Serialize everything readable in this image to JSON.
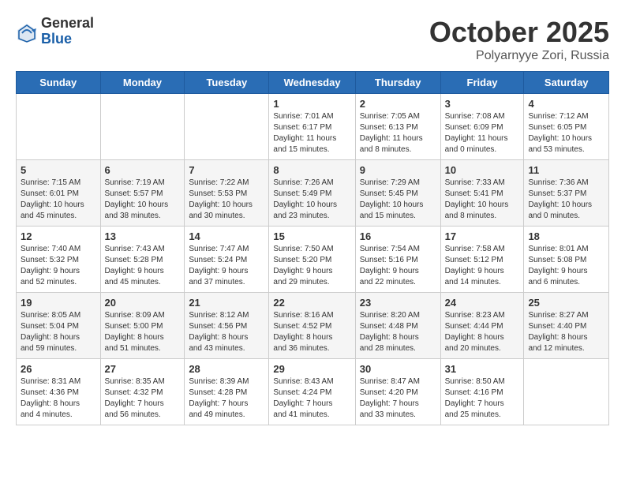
{
  "header": {
    "logo_general": "General",
    "logo_blue": "Blue",
    "month_title": "October 2025",
    "subtitle": "Polyarnyye Zori, Russia"
  },
  "days_of_week": [
    "Sunday",
    "Monday",
    "Tuesday",
    "Wednesday",
    "Thursday",
    "Friday",
    "Saturday"
  ],
  "weeks": [
    [
      {
        "day": "",
        "info": ""
      },
      {
        "day": "",
        "info": ""
      },
      {
        "day": "",
        "info": ""
      },
      {
        "day": "1",
        "info": "Sunrise: 7:01 AM\nSunset: 6:17 PM\nDaylight: 11 hours\nand 15 minutes."
      },
      {
        "day": "2",
        "info": "Sunrise: 7:05 AM\nSunset: 6:13 PM\nDaylight: 11 hours\nand 8 minutes."
      },
      {
        "day": "3",
        "info": "Sunrise: 7:08 AM\nSunset: 6:09 PM\nDaylight: 11 hours\nand 0 minutes."
      },
      {
        "day": "4",
        "info": "Sunrise: 7:12 AM\nSunset: 6:05 PM\nDaylight: 10 hours\nand 53 minutes."
      }
    ],
    [
      {
        "day": "5",
        "info": "Sunrise: 7:15 AM\nSunset: 6:01 PM\nDaylight: 10 hours\nand 45 minutes."
      },
      {
        "day": "6",
        "info": "Sunrise: 7:19 AM\nSunset: 5:57 PM\nDaylight: 10 hours\nand 38 minutes."
      },
      {
        "day": "7",
        "info": "Sunrise: 7:22 AM\nSunset: 5:53 PM\nDaylight: 10 hours\nand 30 minutes."
      },
      {
        "day": "8",
        "info": "Sunrise: 7:26 AM\nSunset: 5:49 PM\nDaylight: 10 hours\nand 23 minutes."
      },
      {
        "day": "9",
        "info": "Sunrise: 7:29 AM\nSunset: 5:45 PM\nDaylight: 10 hours\nand 15 minutes."
      },
      {
        "day": "10",
        "info": "Sunrise: 7:33 AM\nSunset: 5:41 PM\nDaylight: 10 hours\nand 8 minutes."
      },
      {
        "day": "11",
        "info": "Sunrise: 7:36 AM\nSunset: 5:37 PM\nDaylight: 10 hours\nand 0 minutes."
      }
    ],
    [
      {
        "day": "12",
        "info": "Sunrise: 7:40 AM\nSunset: 5:32 PM\nDaylight: 9 hours\nand 52 minutes."
      },
      {
        "day": "13",
        "info": "Sunrise: 7:43 AM\nSunset: 5:28 PM\nDaylight: 9 hours\nand 45 minutes."
      },
      {
        "day": "14",
        "info": "Sunrise: 7:47 AM\nSunset: 5:24 PM\nDaylight: 9 hours\nand 37 minutes."
      },
      {
        "day": "15",
        "info": "Sunrise: 7:50 AM\nSunset: 5:20 PM\nDaylight: 9 hours\nand 29 minutes."
      },
      {
        "day": "16",
        "info": "Sunrise: 7:54 AM\nSunset: 5:16 PM\nDaylight: 9 hours\nand 22 minutes."
      },
      {
        "day": "17",
        "info": "Sunrise: 7:58 AM\nSunset: 5:12 PM\nDaylight: 9 hours\nand 14 minutes."
      },
      {
        "day": "18",
        "info": "Sunrise: 8:01 AM\nSunset: 5:08 PM\nDaylight: 9 hours\nand 6 minutes."
      }
    ],
    [
      {
        "day": "19",
        "info": "Sunrise: 8:05 AM\nSunset: 5:04 PM\nDaylight: 8 hours\nand 59 minutes."
      },
      {
        "day": "20",
        "info": "Sunrise: 8:09 AM\nSunset: 5:00 PM\nDaylight: 8 hours\nand 51 minutes."
      },
      {
        "day": "21",
        "info": "Sunrise: 8:12 AM\nSunset: 4:56 PM\nDaylight: 8 hours\nand 43 minutes."
      },
      {
        "day": "22",
        "info": "Sunrise: 8:16 AM\nSunset: 4:52 PM\nDaylight: 8 hours\nand 36 minutes."
      },
      {
        "day": "23",
        "info": "Sunrise: 8:20 AM\nSunset: 4:48 PM\nDaylight: 8 hours\nand 28 minutes."
      },
      {
        "day": "24",
        "info": "Sunrise: 8:23 AM\nSunset: 4:44 PM\nDaylight: 8 hours\nand 20 minutes."
      },
      {
        "day": "25",
        "info": "Sunrise: 8:27 AM\nSunset: 4:40 PM\nDaylight: 8 hours\nand 12 minutes."
      }
    ],
    [
      {
        "day": "26",
        "info": "Sunrise: 8:31 AM\nSunset: 4:36 PM\nDaylight: 8 hours\nand 4 minutes."
      },
      {
        "day": "27",
        "info": "Sunrise: 8:35 AM\nSunset: 4:32 PM\nDaylight: 7 hours\nand 56 minutes."
      },
      {
        "day": "28",
        "info": "Sunrise: 8:39 AM\nSunset: 4:28 PM\nDaylight: 7 hours\nand 49 minutes."
      },
      {
        "day": "29",
        "info": "Sunrise: 8:43 AM\nSunset: 4:24 PM\nDaylight: 7 hours\nand 41 minutes."
      },
      {
        "day": "30",
        "info": "Sunrise: 8:47 AM\nSunset: 4:20 PM\nDaylight: 7 hours\nand 33 minutes."
      },
      {
        "day": "31",
        "info": "Sunrise: 8:50 AM\nSunset: 4:16 PM\nDaylight: 7 hours\nand 25 minutes."
      },
      {
        "day": "",
        "info": ""
      }
    ]
  ]
}
